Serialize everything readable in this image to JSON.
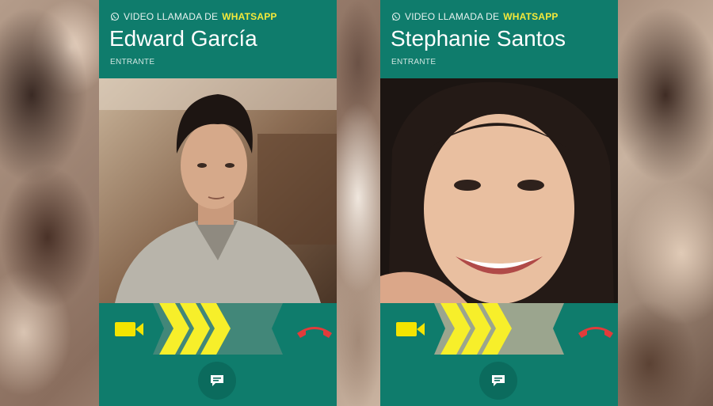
{
  "calls": [
    {
      "call_type_prefix": "VIDEO LLAMADA DE",
      "call_type_brand": "WHATSAPP",
      "caller_name": "Edward García",
      "status": "ENTRANTE"
    },
    {
      "call_type_prefix": "VIDEO LLAMADA DE",
      "call_type_brand": "WHATSAPP",
      "caller_name": "Stephanie Santos",
      "status": "ENTRANTE"
    }
  ],
  "icons": {
    "app": "whatsapp-icon",
    "accept": "video-camera-icon",
    "swipe": "chevron-arrows-icon",
    "decline": "phone-hangup-icon",
    "message": "message-icon"
  },
  "colors": {
    "header": "#0f7c6c",
    "brand_text": "#f4e93a",
    "accept_icon": "#f4e400",
    "decline_icon": "#e23b3b",
    "arrows": "#f7ef2a"
  }
}
